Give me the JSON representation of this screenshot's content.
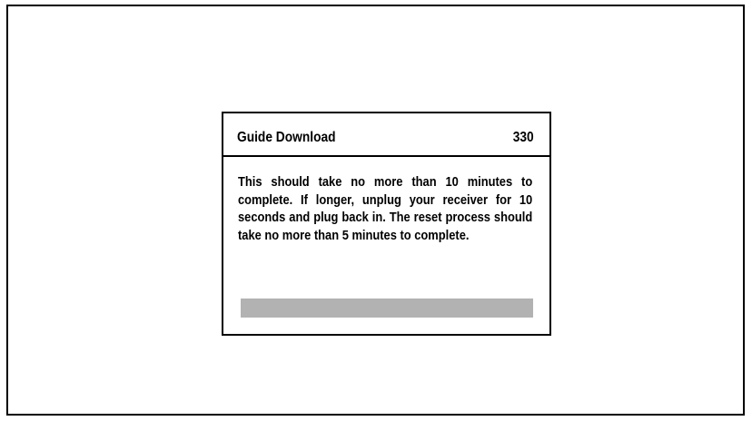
{
  "dialog": {
    "title": "Guide Download",
    "code": "330",
    "message": "This should take no more than 10 minutes to complete. If longer, unplug your receiver for 10 seconds and plug back in. The reset process should take no more than 5 minutes to complete.",
    "progress_percent": 100
  },
  "colors": {
    "background": "#ffffff",
    "border": "#000000",
    "progress": "#b2b2b2"
  }
}
